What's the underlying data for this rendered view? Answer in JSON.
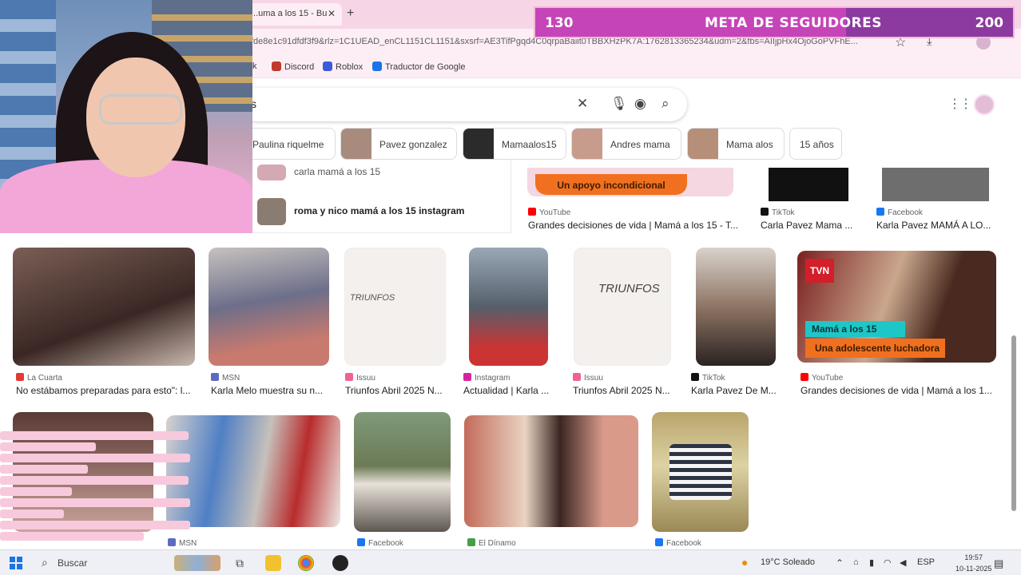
{
  "browser": {
    "tab_title": "...uma a los 15 - Bu",
    "url": "fde8e1c91dfdf3f9&rlz=1C1UEAD_enCL1151CL1151&sxsrf=AE3TifPgqd4C0qrpaBaiit0TBBXHzPK7A:1762813365234&udm=2&fbs=AIIjpHx4OjoGoPVFhE...",
    "bookmarks": [
      {
        "label": "k",
        "color": "#777777"
      },
      {
        "label": "Discord",
        "color": "#c0392b"
      },
      {
        "label": "Roblox",
        "color": "#3b5bdb"
      },
      {
        "label": "Traductor de Google",
        "color": "#1a73e8"
      }
    ]
  },
  "goal_bar": {
    "current": "130",
    "title": "META DE SEGUIDORES",
    "target": "200",
    "progress_fraction": 0.65
  },
  "search": {
    "query": "s",
    "clear_icon": "close-icon",
    "voice_icon": "microphone-icon",
    "lens_icon": "camera-icon",
    "search_icon": "search-icon"
  },
  "chips": [
    {
      "label": "Paulina riquelme",
      "thumb": "#d9c7bd"
    },
    {
      "label": "Pavez gonzalez",
      "thumb": "#a98b7e"
    },
    {
      "label": "Mamaalos15",
      "thumb": "#2b2b2b"
    },
    {
      "label": "Andres mama",
      "thumb": "#c89c8d"
    },
    {
      "label": "Mama alos",
      "thumb": "#b58f78"
    },
    {
      "label": "15 años",
      "thumb": ""
    }
  ],
  "suggestions": [
    {
      "text": "carla mamá a los 15"
    },
    {
      "text": "roma y nico mamá a los 15 instagram"
    }
  ],
  "top_results": [
    {
      "source": "YouTube",
      "caption": "Grandes decisiones de vida | Mamá a los 15 - T...",
      "banner": "Un apoyo incondicional",
      "icon_color": "#ff0000"
    },
    {
      "source": "TikTok",
      "caption": "Carla Pavez Mama ...",
      "icon_color": "#111111"
    },
    {
      "source": "Facebook",
      "caption": "Karla Pavez MAMÁ A LO...",
      "icon_color": "#1877f2"
    }
  ],
  "row1": [
    {
      "source": "La Cuarta",
      "caption": "No estábamos preparadas para esto\": l...",
      "icon_color": "#e53935"
    },
    {
      "source": "MSN",
      "caption": "Karla Melo muestra su n...",
      "icon_color": "#5c6bc0"
    },
    {
      "source": "Issuu",
      "caption": "Triunfos Abril 2025 N...",
      "icon_color": "#f06292",
      "overlay": "TRIUNFOS"
    },
    {
      "source": "Instagram",
      "caption": "Actualidad | Karla ...",
      "icon_color": "#d6249f"
    },
    {
      "source": "Issuu",
      "caption": "Triunfos Abril 2025 N...",
      "icon_color": "#f06292",
      "overlay": "TRIUNFOS"
    },
    {
      "source": "TikTok",
      "caption": "Karla Pavez De M...",
      "icon_color": "#111111"
    },
    {
      "source": "YouTube",
      "caption": "Grandes decisiones de vida | Mamá a los 1...",
      "icon_color": "#ff0000",
      "channel": "TVN",
      "banner_top": "Mamá a los 15",
      "banner_bottom": "Una adolescente luchadora"
    }
  ],
  "row2": [
    {
      "source": "",
      "icon_color": "#5c6bc0"
    },
    {
      "source": "MSN",
      "icon_color": "#5c6bc0"
    },
    {
      "source": "Facebook",
      "icon_color": "#1877f2"
    },
    {
      "source": "El Dínamo",
      "icon_color": "#43a047"
    },
    {
      "source": "Facebook",
      "icon_color": "#1877f2"
    }
  ],
  "taskbar": {
    "search_label": "Buscar",
    "weather": "19°C  Soleado",
    "language": "ESP",
    "time": "19:57",
    "date": "10-11-2025"
  }
}
